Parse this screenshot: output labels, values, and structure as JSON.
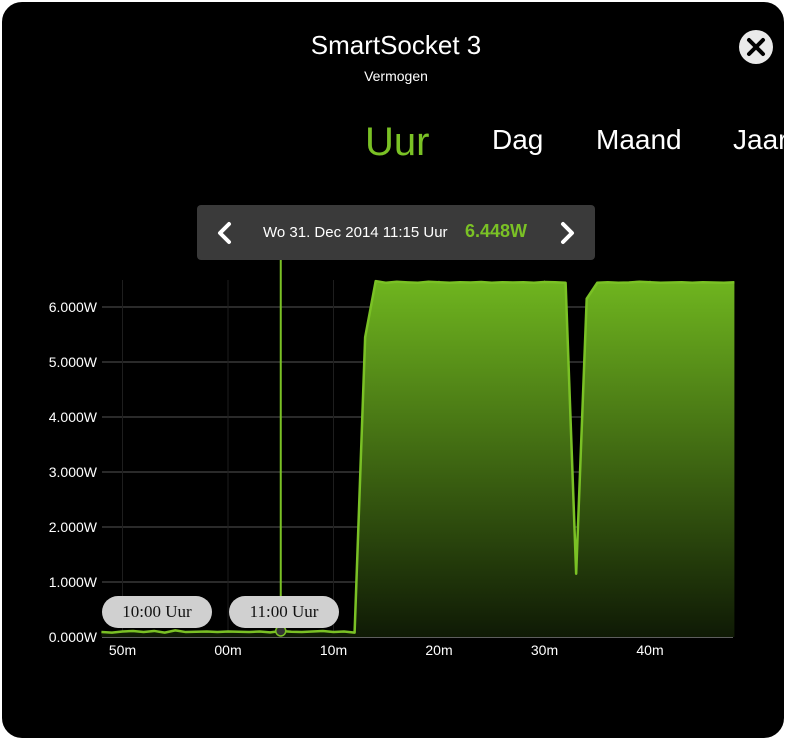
{
  "header": {
    "title": "SmartSocket 3",
    "subtitle": "Vermogen"
  },
  "tabs": [
    {
      "label": "Uur",
      "active": true
    },
    {
      "label": "Dag",
      "active": false
    },
    {
      "label": "Maand",
      "active": false
    },
    {
      "label": "Jaar",
      "active": false
    }
  ],
  "tooltip": {
    "date": "Wo 31. Dec 2014 11:15 Uur",
    "value": "6.448W"
  },
  "pills": [
    {
      "label": "10:00 Uur"
    },
    {
      "label": "11:00 Uur"
    }
  ],
  "colors": {
    "accent": "#7ac125",
    "area_top": "#6fb51f",
    "area_bottom": "#0f1a05",
    "background": "#000000"
  },
  "icons": {
    "close": "close-icon",
    "prev": "chevron-left-icon",
    "next": "chevron-right-icon"
  },
  "chart_data": {
    "type": "area",
    "ylim": [
      0,
      6500
    ],
    "ytick_values": [
      0,
      1000,
      2000,
      3000,
      4000,
      5000,
      6000
    ],
    "ytick_labels": [
      "0.000W",
      "1.000W",
      "2.000W",
      "3.000W",
      "4.000W",
      "5.000W",
      "6.000W"
    ],
    "xtick_values": [
      -10,
      0,
      10,
      20,
      30,
      40
    ],
    "xtick_labels": [
      "50m",
      "00m",
      "10m",
      "20m",
      "30m",
      "40m"
    ],
    "xlim": [
      -12,
      48
    ],
    "grid": true,
    "highlight_index": 17,
    "series": [
      {
        "x": [
          -12,
          -11,
          -10,
          -9,
          -8,
          -7,
          -6,
          -5,
          -4,
          -3,
          -2,
          -1,
          0,
          1,
          2,
          3,
          4,
          5,
          6,
          7,
          8,
          9,
          10,
          11,
          12,
          13,
          14,
          15,
          16,
          17,
          18,
          19,
          20,
          21,
          22,
          23,
          24,
          25,
          26,
          27,
          28,
          29,
          30,
          31,
          32,
          33,
          34,
          35,
          36,
          37,
          38,
          39,
          40,
          41,
          42,
          43,
          44,
          45,
          46,
          47,
          48
        ],
        "y": [
          90,
          80,
          100,
          110,
          90,
          110,
          80,
          120,
          90,
          95,
          100,
          90,
          100,
          95,
          90,
          100,
          85,
          110,
          95,
          90,
          100,
          110,
          90,
          100,
          80,
          5450,
          6470,
          6440,
          6460,
          6448,
          6440,
          6460,
          6450,
          6440,
          6450,
          6445,
          6455,
          6440,
          6450,
          6445,
          6450,
          6440,
          6455,
          6450,
          6440,
          1150,
          6150,
          6440,
          6450,
          6440,
          6445,
          6460,
          6450,
          6440,
          6445,
          6450,
          6440,
          6450,
          6445,
          6440,
          6450
        ]
      }
    ]
  }
}
